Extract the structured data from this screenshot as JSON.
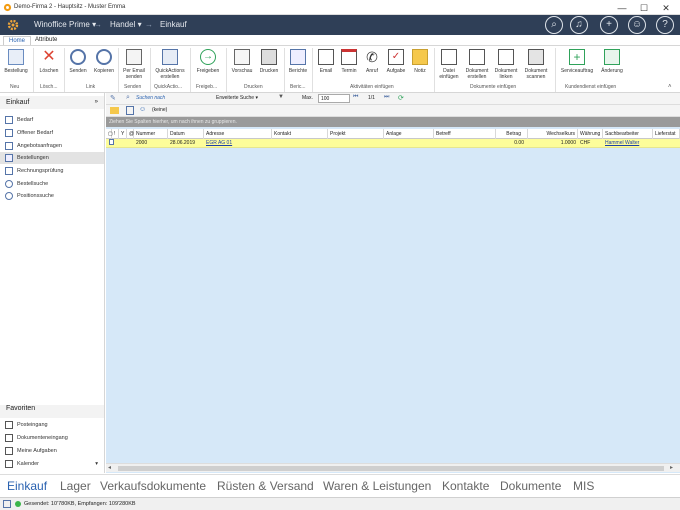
{
  "window": {
    "title": "Demo-Firma 2 - Hauptsitz - Muster Emma",
    "minimize": "—",
    "maximize": "☐",
    "close": "✕"
  },
  "header": {
    "app": "Winoffice Prime ▾",
    "breadcrumb_1": "Handel ▾",
    "breadcrumb_2": "Einkauf",
    "arrow": "→"
  },
  "tabs": {
    "home": "Home",
    "attribute": "Attribute"
  },
  "ribbon": {
    "bestellung": "Bestellung",
    "loeschen": "Löschen",
    "senden": "Senden",
    "kopieren": "Kopieren",
    "per_email": "Per Email senden",
    "quickactions": "QuickActions erstellen",
    "freigeben": "Freigeben",
    "vorschau": "Vorschau",
    "drucken": "Drucken",
    "berichte": "Berichte",
    "email": "Email",
    "termin": "Termin",
    "anruf": "Anruf",
    "aufgabe": "Aufgabe",
    "notiz": "Notiz",
    "datei_einfuegen": "Datei einfügen",
    "dok_erstellen": "Dokument erstellen",
    "dok_linken": "Dokument linken",
    "dok_scannen": "Dokument scannen",
    "serviceauftrag": "Serviceauftrag",
    "aenderung": "Änderung",
    "groups": {
      "neu": "Neu",
      "loesch": "Lösch...",
      "link": "Link",
      "senden": "Senden",
      "quickactio": "QuickActio...",
      "freigeb": "Freigeb...",
      "drucken": "Drucken",
      "beric": "Beric...",
      "aktivitaeten": "Aktivitäten einfügen",
      "dokumente": "Dokumente einfügen",
      "kundendienst": "Kundendienst einfügen"
    }
  },
  "sidebar": {
    "title": "Einkauf",
    "items": [
      {
        "label": "Bedarf"
      },
      {
        "label": "Offener Bedarf"
      },
      {
        "label": "Angebotsanfragen"
      },
      {
        "label": "Bestellungen"
      },
      {
        "label": "Rechnungsprüfung"
      },
      {
        "label": "Bestellsuche"
      },
      {
        "label": "Positionssuche"
      }
    ],
    "fav_title": "Favoriten",
    "favs": [
      {
        "label": "Posteingang"
      },
      {
        "label": "Dokumenteneingang"
      },
      {
        "label": "Meine Aufgaben"
      },
      {
        "label": "Kalender"
      }
    ]
  },
  "toolbar": {
    "search_placeholder": "Suchen nach",
    "adv_search": "Erweiterte Suche ▾",
    "max_label": "Max.",
    "max_value": "100",
    "page": "1/1",
    "filter": "(keine)"
  },
  "grid": {
    "group_hint": "Ziehen Sie Spalten hierher, um nach ihnen zu gruppieren.",
    "columns": [
      "Nummer",
      "Datum",
      "Adresse",
      "Kontakt",
      "Projekt",
      "Anlage",
      "Betreff",
      "Betrag",
      "Wechselkurs",
      "Währung",
      "Sachbearbeiter",
      "Lieferstat"
    ],
    "rows": [
      {
        "nummer": "2000",
        "datum": "28.06.2019",
        "adresse": "EGR AG 01",
        "kontakt": "",
        "projekt": "",
        "anlage": "",
        "betreff": "",
        "betrag": "0.00",
        "wechselkurs": "1.0000",
        "waehrung": "CHF",
        "sachbearbeiter": "Hammel Walter"
      }
    ]
  },
  "modules": [
    "Einkauf",
    "Lager",
    "Verkaufsdokumente",
    "Rüsten & Versand",
    "Waren & Leistungen",
    "Kontakte",
    "Dokumente",
    "MIS"
  ],
  "status": {
    "text": "Gesendet: 10'780KB, Empfangen: 109'280KB"
  },
  "colors": {
    "header": "#2f3f57",
    "accent": "#2a62b0",
    "row_highlight": "#fdfd9a",
    "grid_bg": "#d6e8f8"
  }
}
